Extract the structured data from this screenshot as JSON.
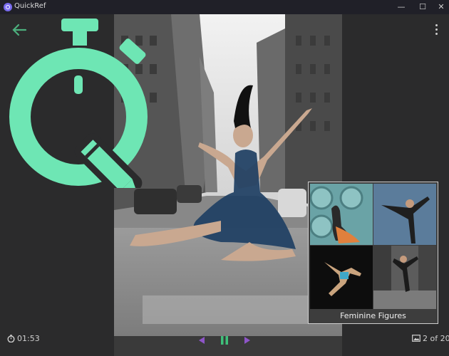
{
  "window": {
    "title": "QuickRef",
    "minimize": "—",
    "maximize": "☐",
    "close": "✕"
  },
  "toolbar": {
    "back_icon": "arrow-left-icon",
    "menu_icon": "kebab-menu-icon"
  },
  "logo": {
    "icon": "stopwatch-pencil-logo",
    "color": "#6ee6b4"
  },
  "photo": {
    "subject": "dancer-leaping-in-city-street"
  },
  "collection": {
    "title": "Feminine Figures",
    "thumbnails": [
      "thumb-seated-figure",
      "thumb-stretching-figure",
      "thumb-leaping-figure",
      "thumb-dancing-figure"
    ]
  },
  "footer": {
    "timer": "01:53",
    "counter": "2 of 20",
    "controls": [
      "previous",
      "pause",
      "next"
    ]
  },
  "colors": {
    "accent": "#6ee6b4",
    "nav": "#8e55c8",
    "pause": "#3fc07a"
  }
}
